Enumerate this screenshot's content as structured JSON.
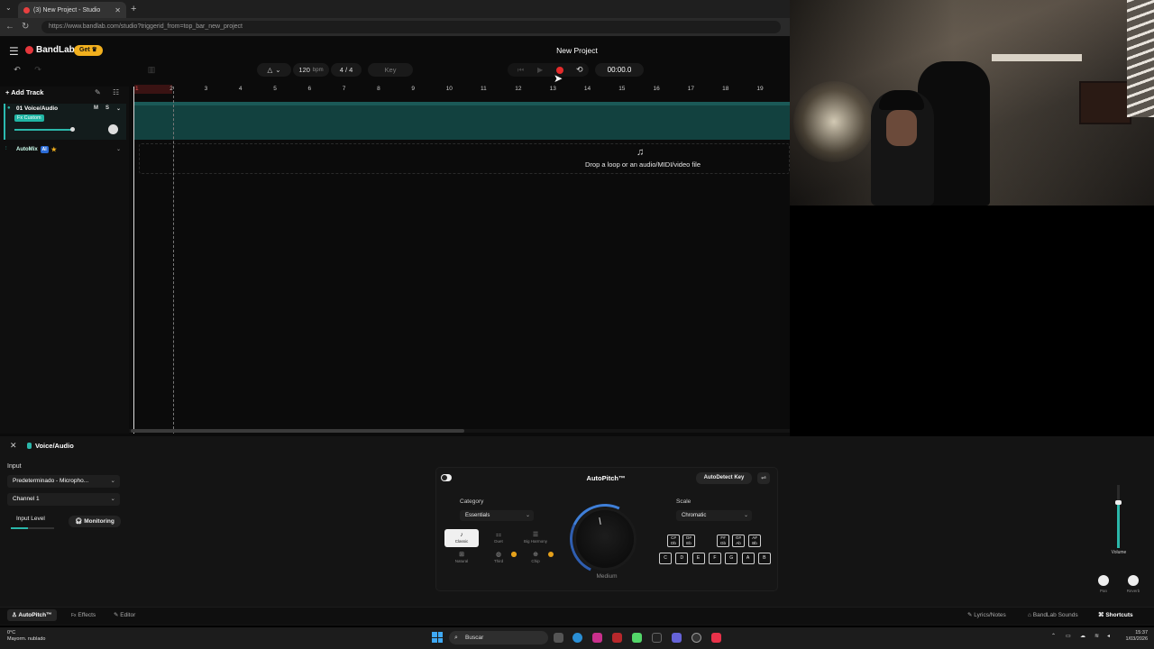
{
  "browser": {
    "tab_title": "(3) New Project - Studio",
    "url": "https://www.bandlab.com/studio?triggerid_from=top_bar_new_project"
  },
  "header": {
    "logo": "BandLab",
    "get_label": "Get",
    "project_title": "New Project",
    "bpm_value": "120",
    "bpm_unit": "bpm",
    "time_signature": "4 / 4",
    "key_label": "Key",
    "time": "00:00.0"
  },
  "tracks": {
    "add_track_label": "Add Track",
    "track": {
      "name": "01  Voice/Audio",
      "fx_tag": "Fx Custom",
      "mute": "M",
      "solo": "S"
    },
    "automix": {
      "label": "AutoMix",
      "ai_badge": "AI"
    }
  },
  "timeline": {
    "bars": [
      "1",
      "2",
      "3",
      "4",
      "5",
      "6",
      "7",
      "8",
      "9",
      "10",
      "11",
      "12",
      "13",
      "14",
      "15",
      "16",
      "17",
      "18",
      "19"
    ],
    "drop_text": "Drop a loop or an audio/MIDI/video file"
  },
  "panel": {
    "track_name": "Voice/Audio",
    "input_label": "Input",
    "input_device": "Predeterminado - Micropho...",
    "channel": "Channel 1",
    "input_level_label": "Input Level",
    "input_level": 0.4,
    "monitoring_label": "Monitoring"
  },
  "autopitch": {
    "title": "AutoPitch™",
    "autodetect_label": "AutoDetect Key",
    "category_label": "Category",
    "category_value": "Essentials",
    "presets": [
      {
        "label": "Classic",
        "icon": "tuning-fork-icon",
        "active": true,
        "locked": false
      },
      {
        "label": "Duet",
        "icon": "duet-icon",
        "active": false,
        "locked": true
      },
      {
        "label": "Big Harmony",
        "icon": "harmony-icon",
        "active": false,
        "locked": true
      },
      {
        "label": "Natural",
        "icon": "natural-icon",
        "active": false,
        "locked": false
      },
      {
        "label": "Third",
        "icon": "third-icon",
        "active": false,
        "locked": true
      },
      {
        "label": "Chip",
        "icon": "chip-icon",
        "active": false,
        "locked": false
      }
    ],
    "knob_label": "Medium",
    "scale_label": "Scale",
    "scale_value": "Chromatic",
    "sharp_keys": [
      {
        "top": "C#",
        "bottom": "Db"
      },
      {
        "top": "D#",
        "bottom": "Eb"
      },
      {
        "top": "F#",
        "bottom": "Gb"
      },
      {
        "top": "G#",
        "bottom": "Ab"
      },
      {
        "top": "A#",
        "bottom": "Bb"
      }
    ],
    "natural_keys": [
      "C",
      "D",
      "E",
      "F",
      "G",
      "A",
      "B"
    ]
  },
  "mixer": {
    "volume_label": "Volume",
    "volume_level": 0.72,
    "pan_label": "Pan",
    "reverb_label": "Reverb"
  },
  "bottom_tabs": {
    "autopitch": "AutoPitch™",
    "effects": "Effects",
    "editor": "Editor",
    "lyrics": "Lyrics/Notes",
    "sounds": "BandLab Sounds",
    "shortcuts": "Shortcuts"
  },
  "taskbar": {
    "temp": "0°C",
    "weather": "Mayorm. nublado",
    "search": "Buscar",
    "time": "15:37",
    "date": "1/03/2026"
  },
  "colors": {
    "accent": "#2bb7aa",
    "record": "#e52b2b",
    "get_button": "#f2b01e"
  }
}
